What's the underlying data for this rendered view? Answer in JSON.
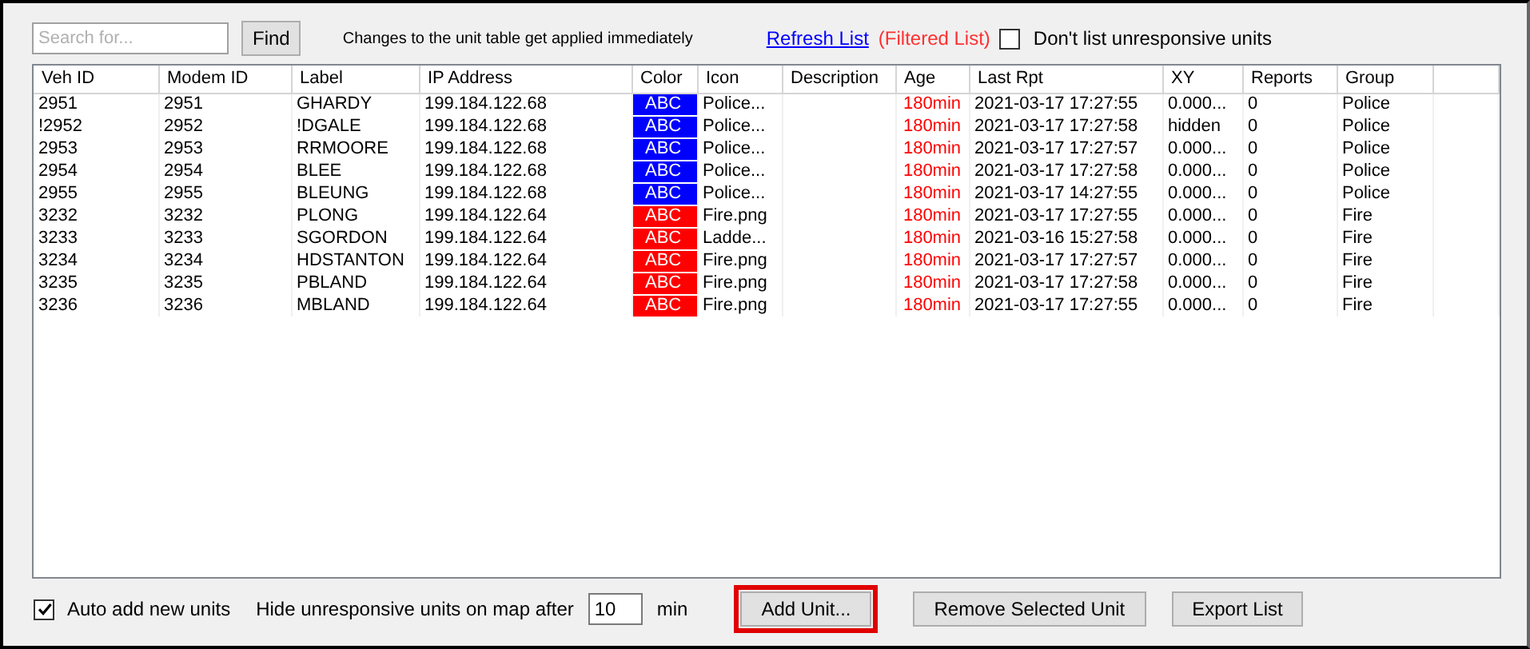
{
  "toolbar": {
    "search": {
      "placeholder": "Search for..."
    },
    "find_button": "Find",
    "notice": "Changes to the unit table get applied immediately",
    "refresh_link": "Refresh List",
    "filter_status": "(Filtered List)",
    "hide_unresponsive": {
      "label": "Don't list unresponsive units",
      "checked": false
    }
  },
  "table": {
    "columns": [
      "Veh ID",
      "Modem ID",
      "Label",
      "IP Address",
      "Color",
      "Icon",
      "Description",
      "Age",
      "Last Rpt",
      "XY",
      "Reports",
      "Group"
    ],
    "rows": [
      {
        "veh_id": "2951",
        "modem_id": "2951",
        "label": "GHARDY",
        "ip": "199.184.122.68",
        "color": "#0000ff",
        "color_text": "ABC",
        "icon": "Police...",
        "age": "180min",
        "last_rpt": "2021-03-17 17:27:55",
        "xy": "0.000...",
        "reports": "0",
        "group": "Police"
      },
      {
        "veh_id": "!2952",
        "modem_id": "2952",
        "label": "!DGALE",
        "ip": "199.184.122.68",
        "color": "#0000ff",
        "color_text": "ABC",
        "icon": "Police...",
        "age": "180min",
        "last_rpt": "2021-03-17 17:27:58",
        "xy": "hidden",
        "reports": "0",
        "group": "Police"
      },
      {
        "veh_id": "2953",
        "modem_id": "2953",
        "label": "RRMOORE",
        "ip": "199.184.122.68",
        "color": "#0000ff",
        "color_text": "ABC",
        "icon": "Police...",
        "age": "180min",
        "last_rpt": "2021-03-17 17:27:57",
        "xy": "0.000...",
        "reports": "0",
        "group": "Police"
      },
      {
        "veh_id": "2954",
        "modem_id": "2954",
        "label": "BLEE",
        "ip": "199.184.122.68",
        "color": "#0000ff",
        "color_text": "ABC",
        "icon": "Police...",
        "age": "180min",
        "last_rpt": "2021-03-17 17:27:58",
        "xy": "0.000...",
        "reports": "0",
        "group": "Police"
      },
      {
        "veh_id": "2955",
        "modem_id": "2955",
        "label": "BLEUNG",
        "ip": "199.184.122.68",
        "color": "#0000ff",
        "color_text": "ABC",
        "icon": "Police...",
        "age": "180min",
        "last_rpt": "2021-03-17 14:27:55",
        "xy": "0.000...",
        "reports": "0",
        "group": "Police"
      },
      {
        "veh_id": "3232",
        "modem_id": "3232",
        "label": "PLONG",
        "ip": "199.184.122.64",
        "color": "#ff0000",
        "color_text": "ABC",
        "icon": "Fire.png",
        "age": "180min",
        "last_rpt": "2021-03-17 17:27:55",
        "xy": "0.000...",
        "reports": "0",
        "group": "Fire"
      },
      {
        "veh_id": "3233",
        "modem_id": "3233",
        "label": "SGORDON",
        "ip": "199.184.122.64",
        "color": "#ff0000",
        "color_text": "ABC",
        "icon": "Ladde...",
        "age": "180min",
        "last_rpt": "2021-03-16 15:27:58",
        "xy": "0.000...",
        "reports": "0",
        "group": "Fire"
      },
      {
        "veh_id": "3234",
        "modem_id": "3234",
        "label": "HDSTANTON",
        "ip": "199.184.122.64",
        "color": "#ff0000",
        "color_text": "ABC",
        "icon": "Fire.png",
        "age": "180min",
        "last_rpt": "2021-03-17 17:27:57",
        "xy": "0.000...",
        "reports": "0",
        "group": "Fire"
      },
      {
        "veh_id": "3235",
        "modem_id": "3235",
        "label": "PBLAND",
        "ip": "199.184.122.64",
        "color": "#ff0000",
        "color_text": "ABC",
        "icon": "Fire.png",
        "age": "180min",
        "last_rpt": "2021-03-17 17:27:58",
        "xy": "0.000...",
        "reports": "0",
        "group": "Fire"
      },
      {
        "veh_id": "3236",
        "modem_id": "3236",
        "label": "MBLAND",
        "ip": "199.184.122.64",
        "color": "#ff0000",
        "color_text": "ABC",
        "icon": "Fire.png",
        "age": "180min",
        "last_rpt": "2021-03-17 17:27:55",
        "xy": "0.000...",
        "reports": "0",
        "group": "Fire"
      }
    ]
  },
  "footer": {
    "auto_add": {
      "label": "Auto add new units",
      "checked": true
    },
    "hide_label": "Hide unresponsive units on map after",
    "hide_minutes": "10",
    "minutes_unit": "min",
    "buttons": [
      {
        "label": "Add Unit...",
        "highlighted": true
      },
      {
        "label": "Remove Selected Unit",
        "highlighted": false
      },
      {
        "label": "Export List",
        "highlighted": false
      }
    ]
  }
}
